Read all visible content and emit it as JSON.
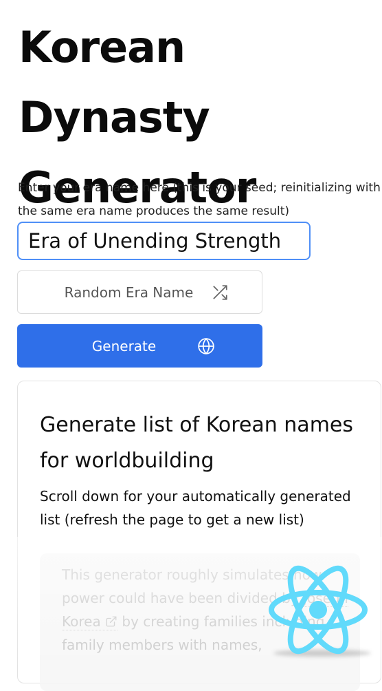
{
  "header": {
    "title": "Korean Dynasty Generator"
  },
  "seed": {
    "label": "Enter your era name here (this is your seed; reinitializing with the same era name produces the same result)",
    "value": "Era of Unending Strength"
  },
  "buttons": {
    "random_label": "Random Era Name",
    "random_icon": "shuffle-icon",
    "generate_label": "Generate",
    "generate_icon": "globe-icon"
  },
  "card": {
    "title": "Generate list of Korean names for worldbuilding",
    "subtitle": "Scroll down for your automatically generated list (refresh the page to get a new list)",
    "intro_start": "This generator roughly simulates how power could have been divided by",
    "intro_link": "Joseon Korea",
    "intro_end": "by creating families including family members with names,"
  },
  "overlay": {
    "logo_icon": "react-logo-icon"
  },
  "colors": {
    "accent": "#2f6fe9",
    "input_border": "#4f8ff7",
    "react": "#61dafb"
  }
}
